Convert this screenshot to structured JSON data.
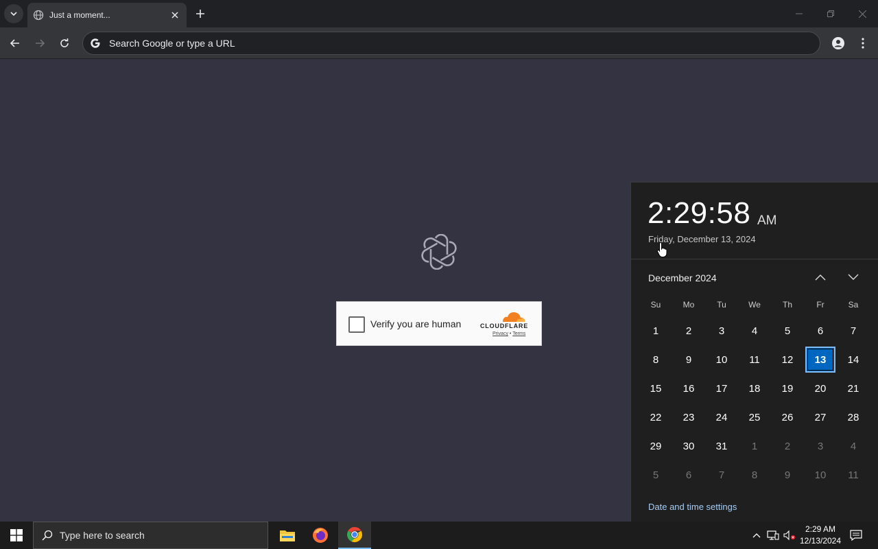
{
  "browser": {
    "tab_title": "Just a moment...",
    "omnibox_placeholder": "Search Google or type a URL"
  },
  "page": {
    "turnstile": {
      "label": "Verify you are human",
      "brand": "CLOUDFLARE",
      "privacy": "Privacy",
      "separator": "•",
      "terms": "Terms"
    }
  },
  "flyout": {
    "time": "2:29:58",
    "ampm": "AM",
    "date": "Friday, December 13, 2024",
    "month": "December 2024",
    "weekdays": [
      "Su",
      "Mo",
      "Tu",
      "We",
      "Th",
      "Fr",
      "Sa"
    ],
    "weeks": [
      [
        "1",
        "2",
        "3",
        "4",
        "5",
        "6",
        "7"
      ],
      [
        "8",
        "9",
        "10",
        "11",
        "12",
        "13",
        "14"
      ],
      [
        "15",
        "16",
        "17",
        "18",
        "19",
        "20",
        "21"
      ],
      [
        "22",
        "23",
        "24",
        "25",
        "26",
        "27",
        "28"
      ],
      [
        "29",
        "30",
        "31",
        "1",
        "2",
        "3",
        "4"
      ],
      [
        "5",
        "6",
        "7",
        "8",
        "9",
        "10",
        "11"
      ]
    ],
    "today": "13",
    "settings_link": "Date and time settings"
  },
  "taskbar": {
    "search_placeholder": "Type here to search",
    "clock_time": "2:29 AM",
    "clock_date": "12/13/2024"
  },
  "colors": {
    "page_bg": "#343341",
    "accent": "#0067c0",
    "cloudflare_orange": "#f38020"
  }
}
